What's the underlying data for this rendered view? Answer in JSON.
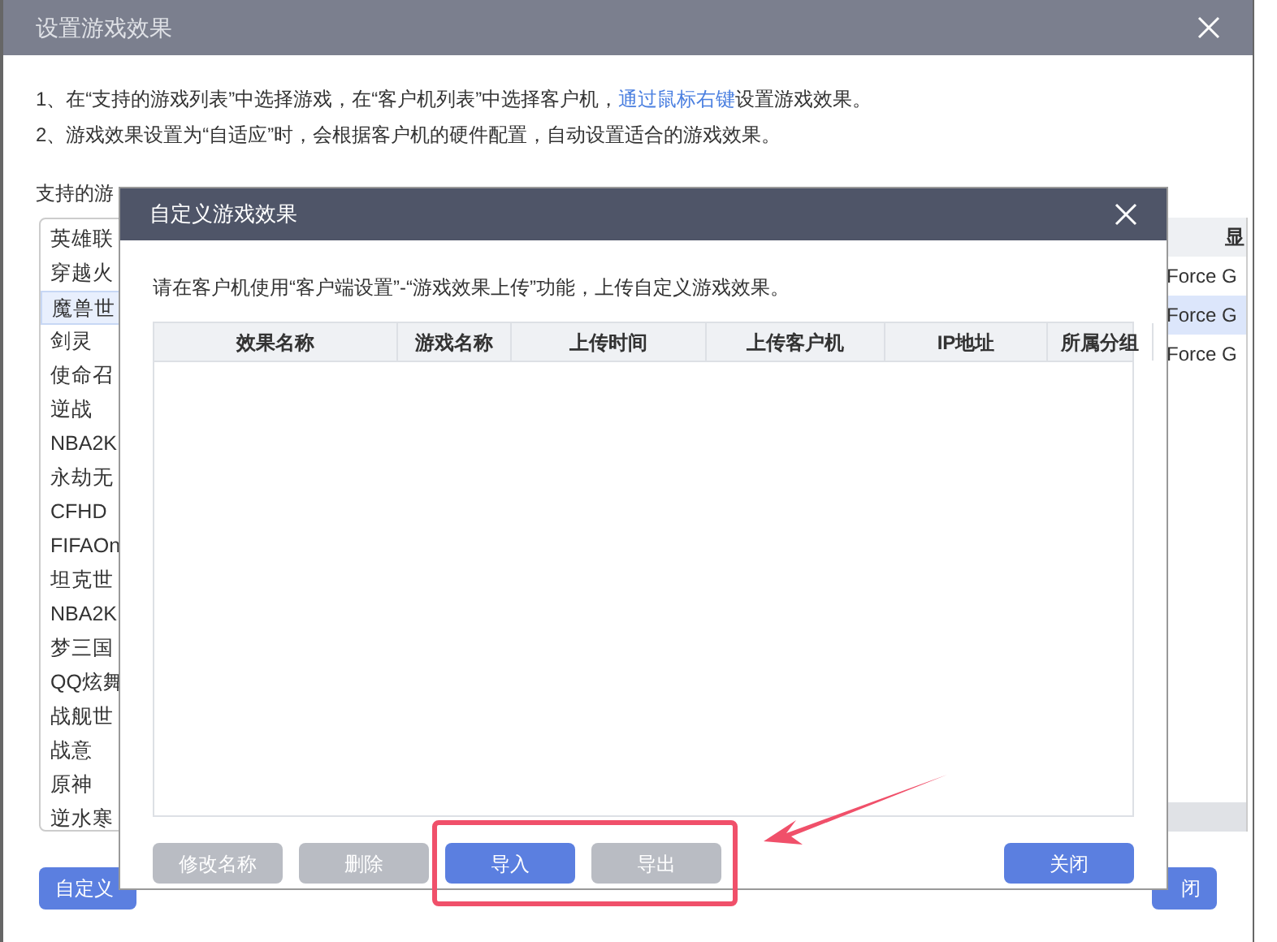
{
  "window": {
    "title": "设置游戏效果"
  },
  "instructions": [
    {
      "before": "1、在“支持的游戏列表”中选择游戏，在“客户机列表”中选择客户机，",
      "link": "通过鼠标右键",
      "after": "设置游戏效果。"
    },
    {
      "before": "2、游戏效果设置为“自适应”时，会根据客户机的硬件配置，自动设置适合的游戏效果。"
    }
  ],
  "games_label": "支持的游",
  "games": [
    {
      "name": "英雄联",
      "selected": false
    },
    {
      "name": "穿越火",
      "selected": false
    },
    {
      "name": "魔兽世",
      "selected": true
    },
    {
      "name": "剑灵",
      "selected": false
    },
    {
      "name": "使命召",
      "selected": false
    },
    {
      "name": "逆战",
      "selected": false
    },
    {
      "name": "NBA2K",
      "selected": false
    },
    {
      "name": "永劫无",
      "selected": false
    },
    {
      "name": "CFHD",
      "selected": false
    },
    {
      "name": "FIFAOn",
      "selected": false
    },
    {
      "name": "坦克世",
      "selected": false
    },
    {
      "name": "NBA2K",
      "selected": false
    },
    {
      "name": "梦三国",
      "selected": false
    },
    {
      "name": "QQ炫舞",
      "selected": false
    },
    {
      "name": "战舰世",
      "selected": false
    },
    {
      "name": "战意",
      "selected": false
    },
    {
      "name": "原神",
      "selected": false
    },
    {
      "name": "逆水寒",
      "selected": false
    }
  ],
  "client_table": {
    "column_header": "显",
    "rows": [
      {
        "cell": "Force G",
        "selected": false
      },
      {
        "cell": "Force G",
        "selected": true
      },
      {
        "cell": "Force G",
        "selected": false
      }
    ]
  },
  "footer_buttons": [
    "自定义",
    "闭"
  ],
  "modal": {
    "title": "自定义游戏效果",
    "hint": "请在客户机使用“客户端设置”-“游戏效果上传”功能，上传自定义游戏效果。",
    "columns": [
      "效果名称",
      "游戏名称",
      "上传时间",
      "上传客户机",
      "IP地址",
      "所属分组"
    ],
    "buttons": [
      {
        "label": "修改名称",
        "disabled": true
      },
      {
        "label": "删除",
        "disabled": true
      },
      {
        "label": "导入",
        "disabled": false
      },
      {
        "label": "导出",
        "disabled": true
      }
    ],
    "close_button": "关闭"
  }
}
